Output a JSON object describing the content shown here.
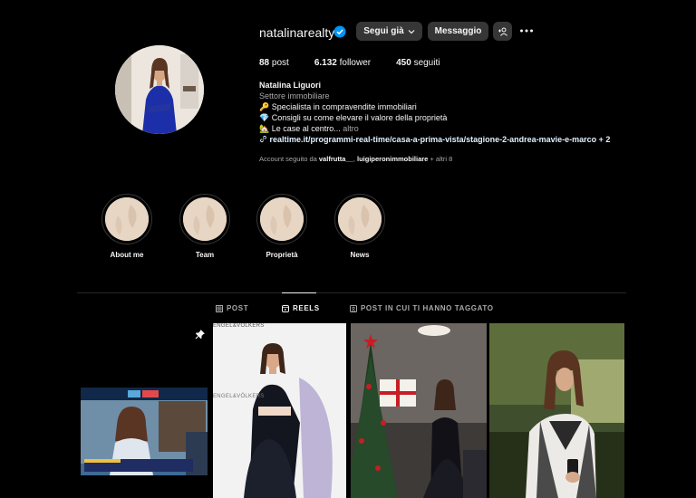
{
  "profile": {
    "username": "natalinarealty",
    "verified": true,
    "buttons": {
      "follow_label": "Segui già",
      "message_label": "Messaggio"
    },
    "stats": {
      "posts_count": "88",
      "posts_label": "post",
      "followers_count": "6.132",
      "followers_label": "follower",
      "following_count": "450",
      "following_label": "seguiti"
    },
    "bio": {
      "name": "Natalina Liguori",
      "category": "Settore immobiliare",
      "line1": "Specialista in compravendite immobiliari",
      "line2": "Consigli su come elevare il valore della proprietà",
      "line3": "Le case al centro...",
      "more": "altro",
      "link": "realtime.it/programmi-real-time/casa-a-prima-vista/stagione-2-andrea-mavie-e-marco",
      "link_extra": "+ 2"
    },
    "followed_by": {
      "prefix": "Account seguito da",
      "user1": "valfrutta__",
      "user2": "luigiperonimmobiliare",
      "suffix": "+ altri 8"
    }
  },
  "highlights": [
    {
      "label": "About me"
    },
    {
      "label": "Team"
    },
    {
      "label": "Proprietà"
    },
    {
      "label": "News"
    }
  ],
  "tabs": [
    {
      "label": "POST",
      "icon": "grid-icon",
      "active": false
    },
    {
      "label": "REELS",
      "icon": "reels-icon",
      "active": true
    },
    {
      "label": "POST IN CUI TI HANNO TAGGATO",
      "icon": "tagged-icon",
      "active": false
    }
  ],
  "reels": {
    "overlay_text_1": "ENGEL&VÖLKERS",
    "overlay_text_2": "ENGEL&VÖLKERS",
    "tv_label": "Real Time"
  },
  "colors": {
    "background": "#000000",
    "button": "#363636",
    "text": "#f5f5f5",
    "muted": "#a8a8a8",
    "verified": "#0095f6",
    "link": "#e0f1ff"
  }
}
